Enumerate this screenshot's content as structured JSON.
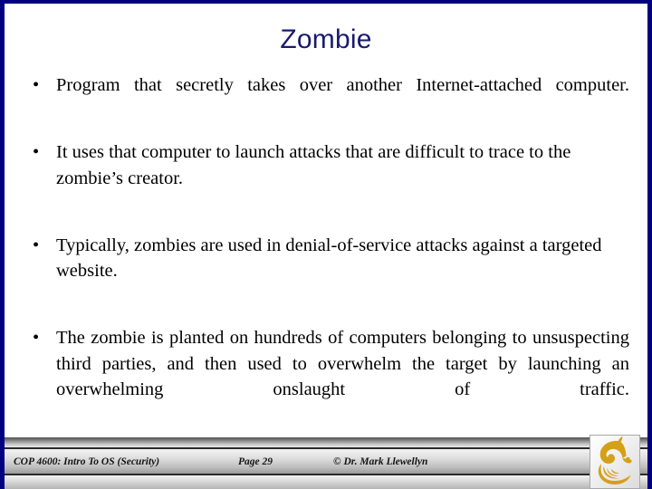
{
  "slide": {
    "title": "Zombie",
    "title_color": "#1a1a6e",
    "border_color": "#000080",
    "background": "#ffffff",
    "bullet_marker": "•",
    "bullets": [
      {
        "text": "Program that secretly takes over another Internet-attached computer.",
        "justified": true
      },
      {
        "text": "It uses that computer to launch attacks that are difficult to trace to the zombie’s creator.",
        "justified": false
      },
      {
        "text": "Typically, zombies are used in denial-of-service attacks against a targeted website.",
        "justified": false
      },
      {
        "text": "The zombie is planted on hundreds of computers belonging to unsuspecting third parties, and then used to overwhelm the target by launching an overwhelming onslaught of traffic.",
        "justified": true
      }
    ]
  },
  "footer": {
    "course": "COP 4600: Intro To OS  (Security)",
    "page": "Page 29",
    "credit": "© Dr. Mark Llewellyn",
    "logo_name": "ucf-pegasus-logo",
    "logo_color": "#d4a017"
  }
}
